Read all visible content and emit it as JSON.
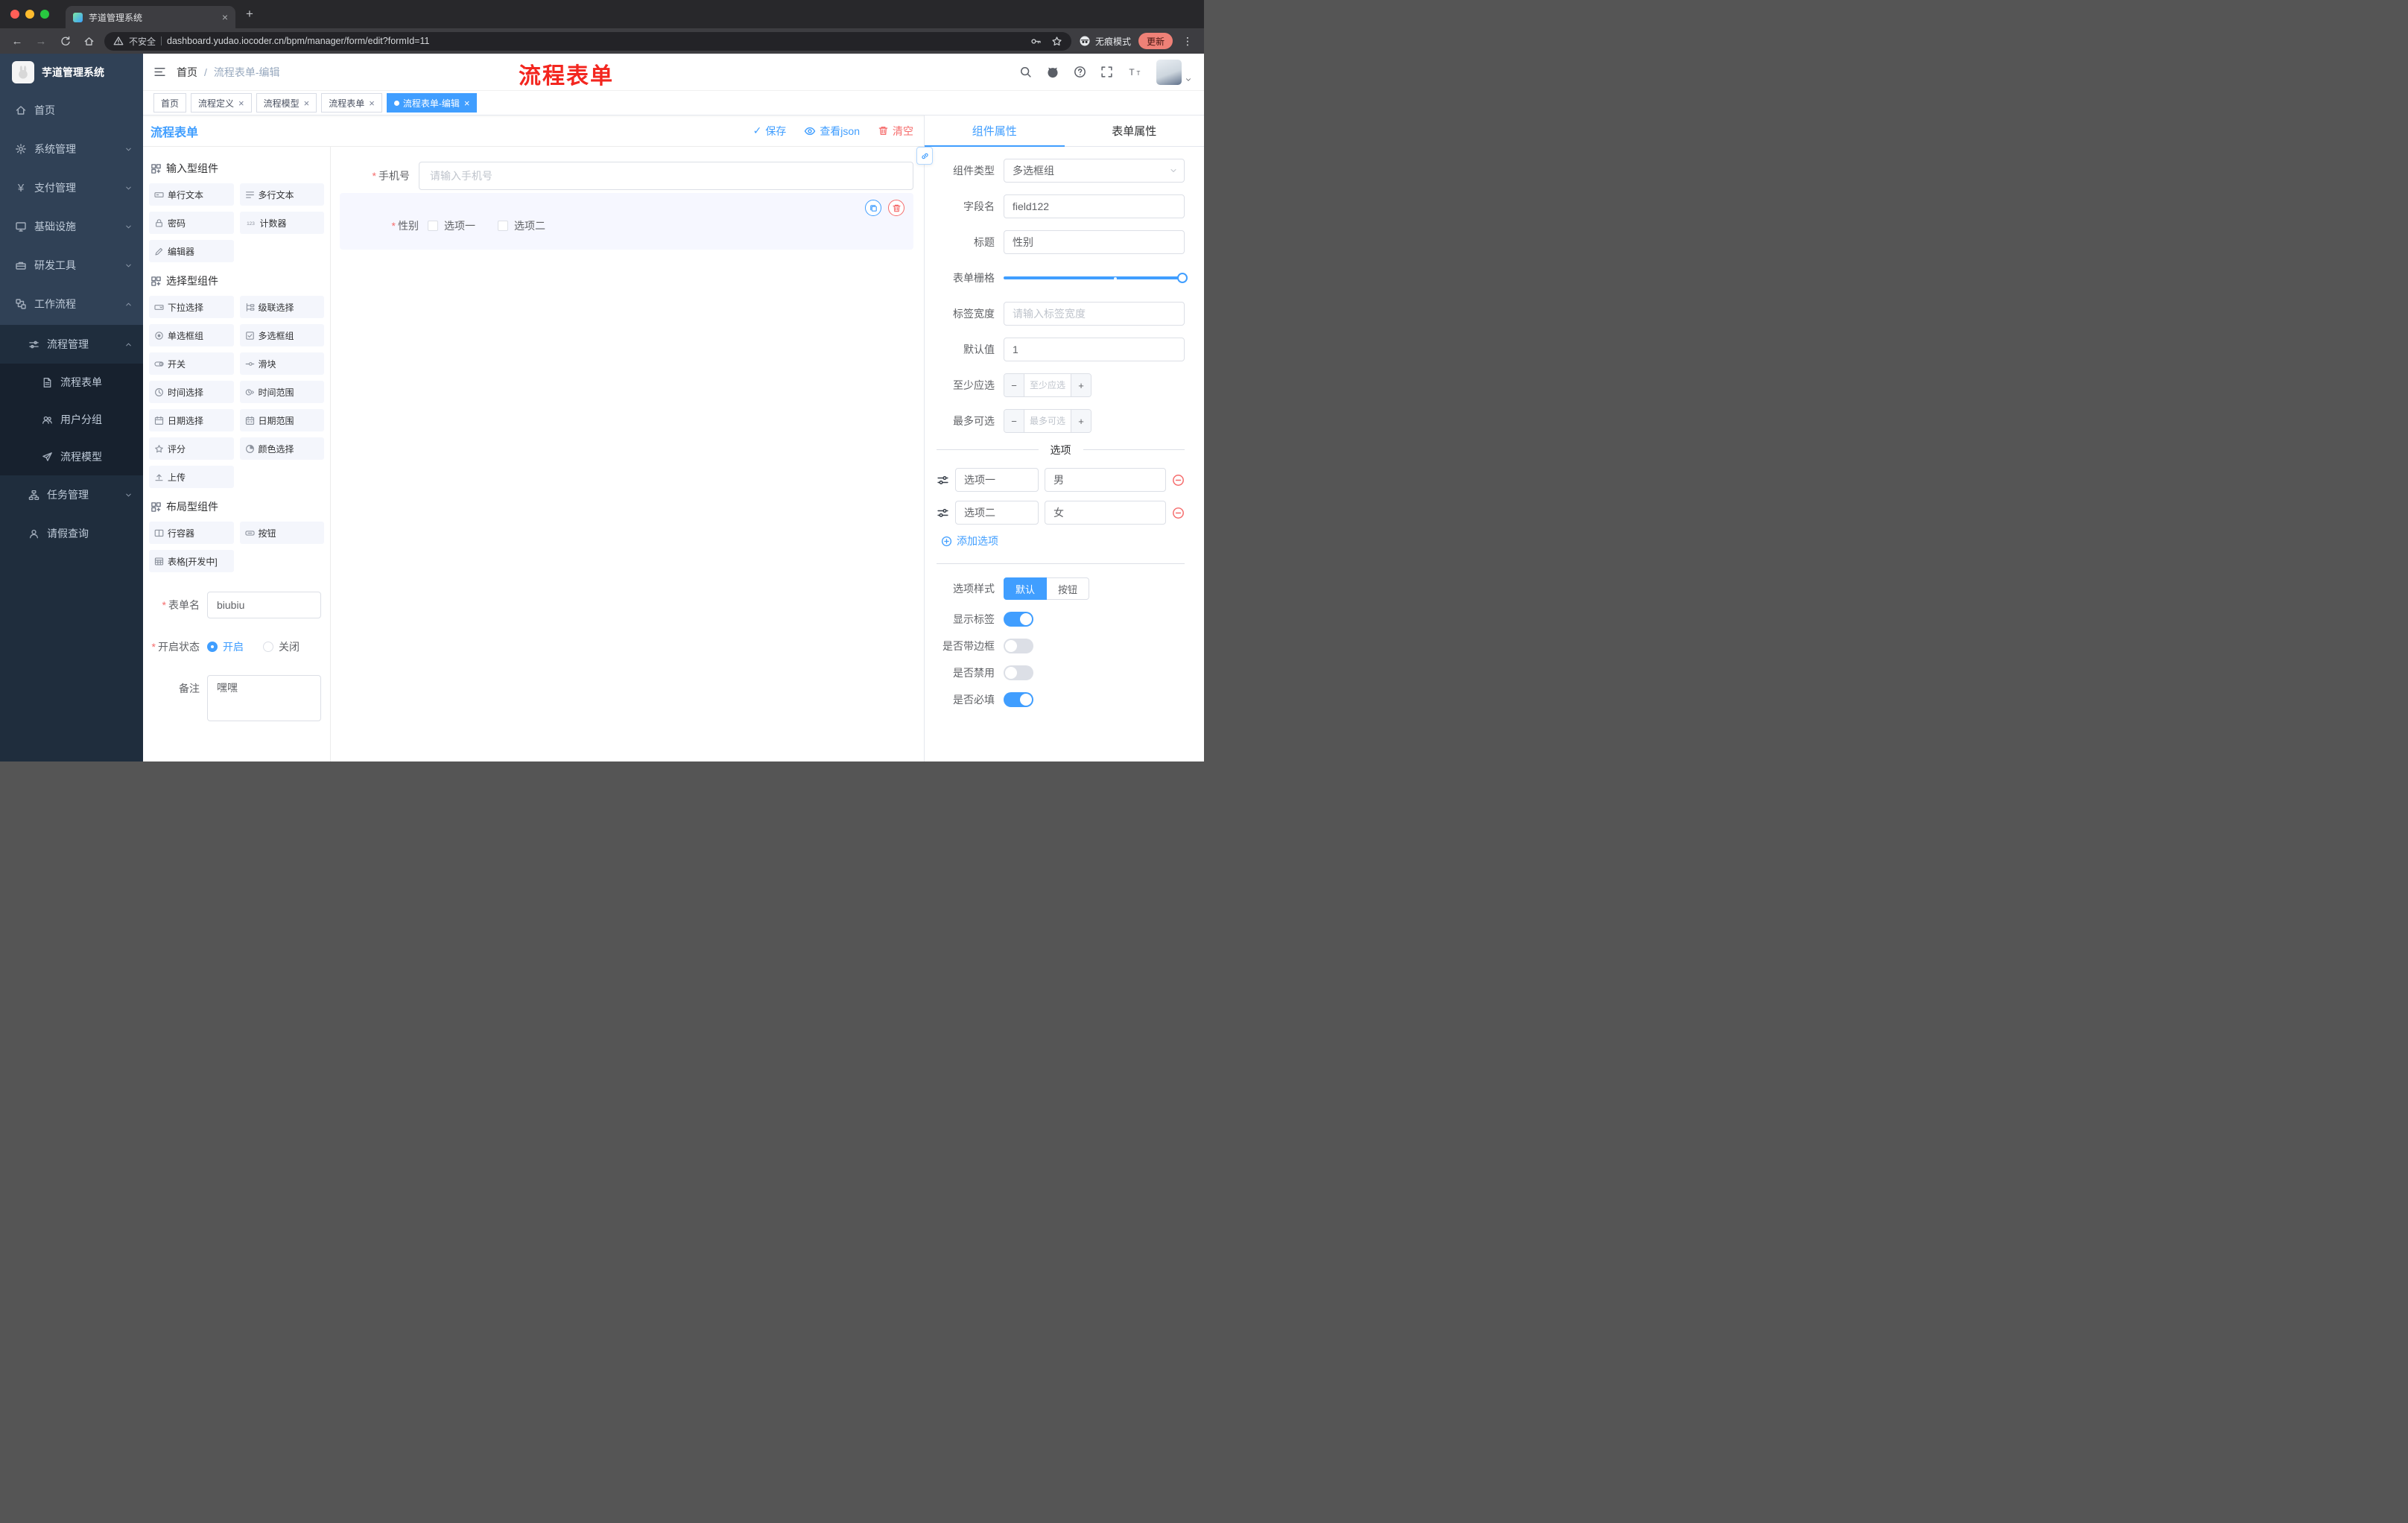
{
  "icons": {
    "back": "←",
    "forward": "→",
    "close": "×",
    "plus": "+",
    "minus": "−",
    "kebab": "⋮",
    "check": "✓",
    "yen": "¥"
  },
  "browser": {
    "tab_title": "芋道管理系统",
    "security_label": "不安全",
    "url": "dashboard.yudao.iocoder.cn/bpm/manager/form/edit?formId=11",
    "incognito_label": "无痕模式",
    "update_label": "更新"
  },
  "sidebar": {
    "logo_title": "芋道管理系统",
    "items": [
      {
        "label": "首页"
      },
      {
        "label": "系统管理"
      },
      {
        "label": "支付管理"
      },
      {
        "label": "基础设施"
      },
      {
        "label": "研发工具"
      },
      {
        "label": "工作流程"
      }
    ],
    "workflow_menu": {
      "process": {
        "label": "流程管理"
      },
      "process_children": [
        {
          "label": "流程表单"
        },
        {
          "label": "用户分组"
        },
        {
          "label": "流程模型"
        }
      ],
      "task": {
        "label": "任务管理"
      },
      "leave": {
        "label": "请假查询"
      }
    }
  },
  "header": {
    "breadcrumb_home": "首页",
    "breadcrumb_current": "流程表单-编辑",
    "annotation": "流程表单"
  },
  "tags": [
    {
      "label": "首页"
    },
    {
      "label": "流程定义"
    },
    {
      "label": "流程模型"
    },
    {
      "label": "流程表单"
    },
    {
      "label": "流程表单-编辑"
    }
  ],
  "designer": {
    "title": "流程表单",
    "actions": {
      "save": "保存",
      "view_json": "查看json",
      "clear": "清空"
    },
    "palette": {
      "groups": [
        {
          "title": "输入型组件",
          "items": [
            {
              "label": "单行文本"
            },
            {
              "label": "多行文本"
            },
            {
              "label": "密码"
            },
            {
              "label": "计数器"
            },
            {
              "label": "编辑器"
            }
          ]
        },
        {
          "title": "选择型组件",
          "items": [
            {
              "label": "下拉选择"
            },
            {
              "label": "级联选择"
            },
            {
              "label": "单选框组"
            },
            {
              "label": "多选框组"
            },
            {
              "label": "开关"
            },
            {
              "label": "滑块"
            },
            {
              "label": "时间选择"
            },
            {
              "label": "时间范围"
            },
            {
              "label": "日期选择"
            },
            {
              "label": "日期范围"
            },
            {
              "label": "评分"
            },
            {
              "label": "颜色选择"
            },
            {
              "label": "上传"
            }
          ]
        },
        {
          "title": "布局型组件",
          "items": [
            {
              "label": "行容器"
            },
            {
              "label": "按钮"
            },
            {
              "label": "表格[开发中]"
            }
          ]
        }
      ]
    },
    "meta": {
      "name_label": "表单名",
      "name_value": "biubiu",
      "status_label": "开启状态",
      "status_on": "开启",
      "status_off": "关闭",
      "remark_label": "备注",
      "remark_value": "嘿嘿"
    },
    "canvas": {
      "phone_label": "手机号",
      "phone_placeholder": "请输入手机号",
      "gender_label": "性别",
      "gender_options": [
        {
          "label": "选项一"
        },
        {
          "label": "选项二"
        }
      ]
    },
    "props": {
      "tab_component": "组件属性",
      "tab_form": "表单属性",
      "type_label": "组件类型",
      "type_value": "多选框组",
      "field_label": "字段名",
      "field_value": "field122",
      "title_label": "标题",
      "title_value": "性别",
      "grid_label": "表单栅格",
      "label_width_label": "标签宽度",
      "label_width_placeholder": "请输入标签宽度",
      "default_label": "默认值",
      "default_value": "1",
      "min_label": "至少应选",
      "min_placeholder": "至少应选",
      "max_label": "最多可选",
      "max_placeholder": "最多可选",
      "options_divider": "选项",
      "options": [
        {
          "name": "选项一",
          "value": "男"
        },
        {
          "name": "选项二",
          "value": "女"
        }
      ],
      "add_option": "添加选项",
      "style_label": "选项样式",
      "style_default": "默认",
      "style_button": "按钮",
      "switches": [
        {
          "label": "显示标签",
          "on": true
        },
        {
          "label": "是否带边框",
          "on": false
        },
        {
          "label": "是否禁用",
          "on": false
        },
        {
          "label": "是否必填",
          "on": true
        }
      ]
    }
  }
}
